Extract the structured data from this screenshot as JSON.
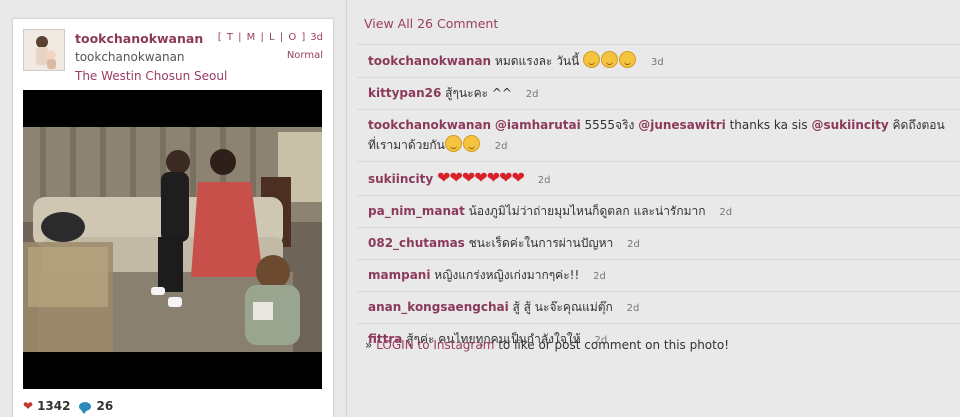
{
  "post": {
    "owner": "tookchanokwanan",
    "owner_sub": "tookchanokwanan",
    "location": "The Westin Chosun Seoul",
    "formats": "[ T | M | L | O ]",
    "time": "3d",
    "filter": "Normal",
    "likes": "1342",
    "comments": "26"
  },
  "view_all": "View All 26 Comment",
  "comments": [
    {
      "user": "tookchanokwanan",
      "text": "หมดแรงละ วันนี้",
      "emoji_count": 3,
      "time": "3d"
    },
    {
      "user": "kittypan26",
      "text": "สู้ๆนะคะ ^^",
      "time": "2d"
    },
    {
      "user": "tookchanokwanan",
      "mention1": "@iamharutai",
      "text1": "5555จริง",
      "mention2": "@junesawitri",
      "text2": "thanks ka sis",
      "mention3": "@sukiincity",
      "text3": "คิดถึงตอนที่เรามาด้วยกัน",
      "emoji_count": 2,
      "time": "2d"
    },
    {
      "user": "sukiincity",
      "hearts": "❤❤❤❤❤❤❤",
      "time": "2d"
    },
    {
      "user": "pa_nim_manat",
      "text": "น้องภูมิไม่ว่าถ่ายมุมไหนก็ดูตลก และน่ารักมาก",
      "time": "2d"
    },
    {
      "user": "082_chutamas",
      "text": "ชนะเร็ดค่ะในการผ่านปัญหา",
      "time": "2d"
    },
    {
      "user": "mampani",
      "text": "หญิงแกร่งหญิงเก่งมากๆค่ะ!!",
      "time": "2d"
    },
    {
      "user": "anan_kongsaengchai",
      "text": "สู้ สู้ นะจ๊ะคุณแม่ตุ๊ก",
      "time": "2d"
    },
    {
      "user": "fittra",
      "text": "สู้ๆค่ะ คนไทยทุกคนเป็นกำลังใจให้",
      "time": "2d"
    }
  ],
  "login": {
    "prefix": "» ",
    "link": "LOGIN to Instagram",
    "suffix": " to like or post comment on this photo!"
  }
}
